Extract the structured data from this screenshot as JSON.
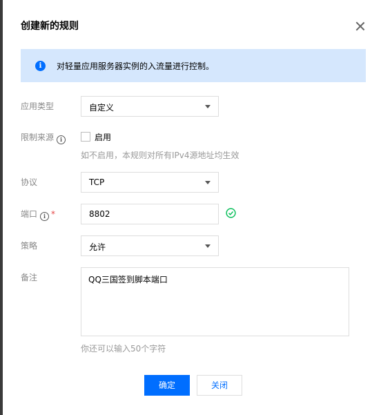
{
  "dialog": {
    "title": "创建新的规则",
    "notice": "对轻量应用服务器实例的入流量进行控制。"
  },
  "form": {
    "app_type": {
      "label": "应用类型",
      "value": "自定义"
    },
    "limit_source": {
      "label": "限制来源",
      "checkbox_label": "启用",
      "checked": false,
      "hint": "如不启用，本规则对所有IPv4源地址均生效"
    },
    "protocol": {
      "label": "协议",
      "value": "TCP"
    },
    "port": {
      "label": "端口",
      "required_mark": "*",
      "value": "8802",
      "valid": true
    },
    "policy": {
      "label": "策略",
      "value": "允许"
    },
    "remark": {
      "label": "备注",
      "value": "QQ三国签到脚本端口",
      "hint": "你还可以输入50个字符"
    }
  },
  "buttons": {
    "confirm": "确定",
    "close": "关闭"
  },
  "colors": {
    "primary": "#006eff",
    "notice_bg": "#d5e7fd",
    "success": "#0abf5b",
    "required": "#e54545"
  }
}
